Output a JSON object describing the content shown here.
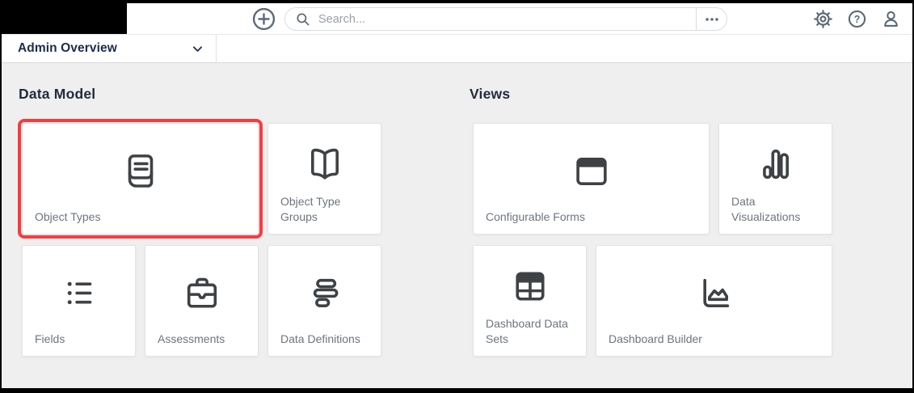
{
  "topbar": {
    "search_placeholder": "Search..."
  },
  "nav": {
    "workspace": "Admin Overview"
  },
  "sections": [
    {
      "title": "Data Model",
      "cards": [
        {
          "label": "Object Types",
          "icon": "book",
          "wide": true,
          "highlighted": true
        },
        {
          "label": "Object Type Groups",
          "icon": "book-open"
        },
        {
          "label": "Fields",
          "icon": "list"
        },
        {
          "label": "Assessments",
          "icon": "briefcase"
        },
        {
          "label": "Data Definitions",
          "icon": "data-definitions"
        }
      ]
    },
    {
      "title": "Views",
      "cards": [
        {
          "label": "Configurable Forms",
          "icon": "window",
          "wide": true
        },
        {
          "label": "Data Visualizations",
          "icon": "bar-chart"
        },
        {
          "label": "Dashboard Data Sets",
          "icon": "table"
        },
        {
          "label": "Dashboard Builder",
          "icon": "chart-area",
          "wide": true
        }
      ]
    }
  ],
  "colors": {
    "highlight": "#F93B3F",
    "nav_text": "#1B2B4D",
    "heading_text": "#222C3A",
    "icon_slate": "#5C6A77",
    "card_icon": "#3E4245",
    "card_label": "#6B7580"
  }
}
